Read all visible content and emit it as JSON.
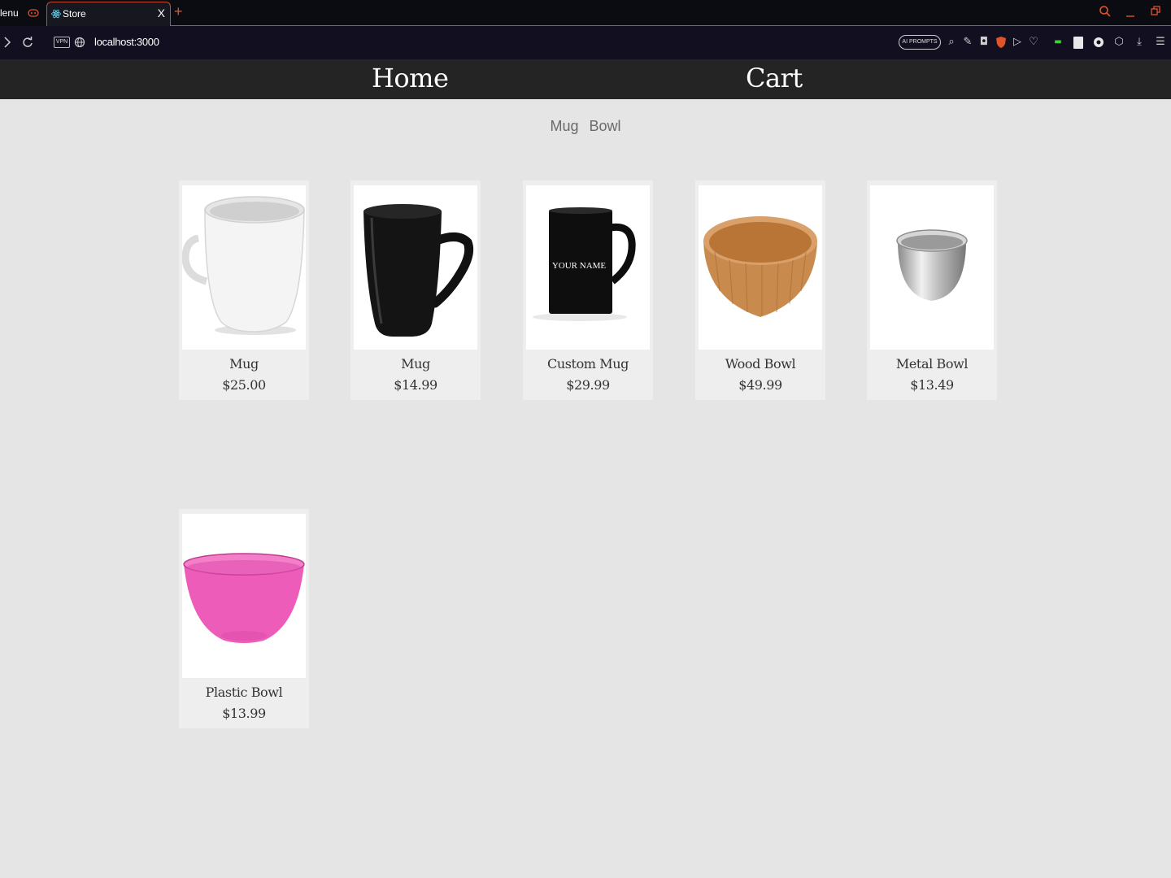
{
  "browser": {
    "prev_tab_label": "lenu",
    "active_tab_title": "Store",
    "tab_close": "X",
    "new_tab": "+",
    "url": "localhost:3000",
    "vpn_label": "VPN",
    "ai_prompts_label": "AI PROMPTS"
  },
  "nav": {
    "home": "Home",
    "cart": "Cart"
  },
  "filters": [
    "Mug",
    "Bowl"
  ],
  "products": [
    {
      "name": "Mug",
      "price": "$25.00",
      "image": "white-mug"
    },
    {
      "name": "Mug",
      "price": "$14.99",
      "image": "black-mug"
    },
    {
      "name": "Custom Mug",
      "price": "$29.99",
      "image": "custom-mug",
      "image_text": "YOUR NAME"
    },
    {
      "name": "Wood Bowl",
      "price": "$49.99",
      "image": "wood-bowl"
    },
    {
      "name": "Metal Bowl",
      "price": "$13.49",
      "image": "metal-bowl"
    },
    {
      "name": "Plastic Bowl",
      "price": "$13.99",
      "image": "plastic-bowl"
    }
  ],
  "colors": {
    "page_bg": "#e5e5e5",
    "nav_bg": "#242424",
    "card_bg": "#eeeeee",
    "browser_accent": "#e0532b"
  }
}
